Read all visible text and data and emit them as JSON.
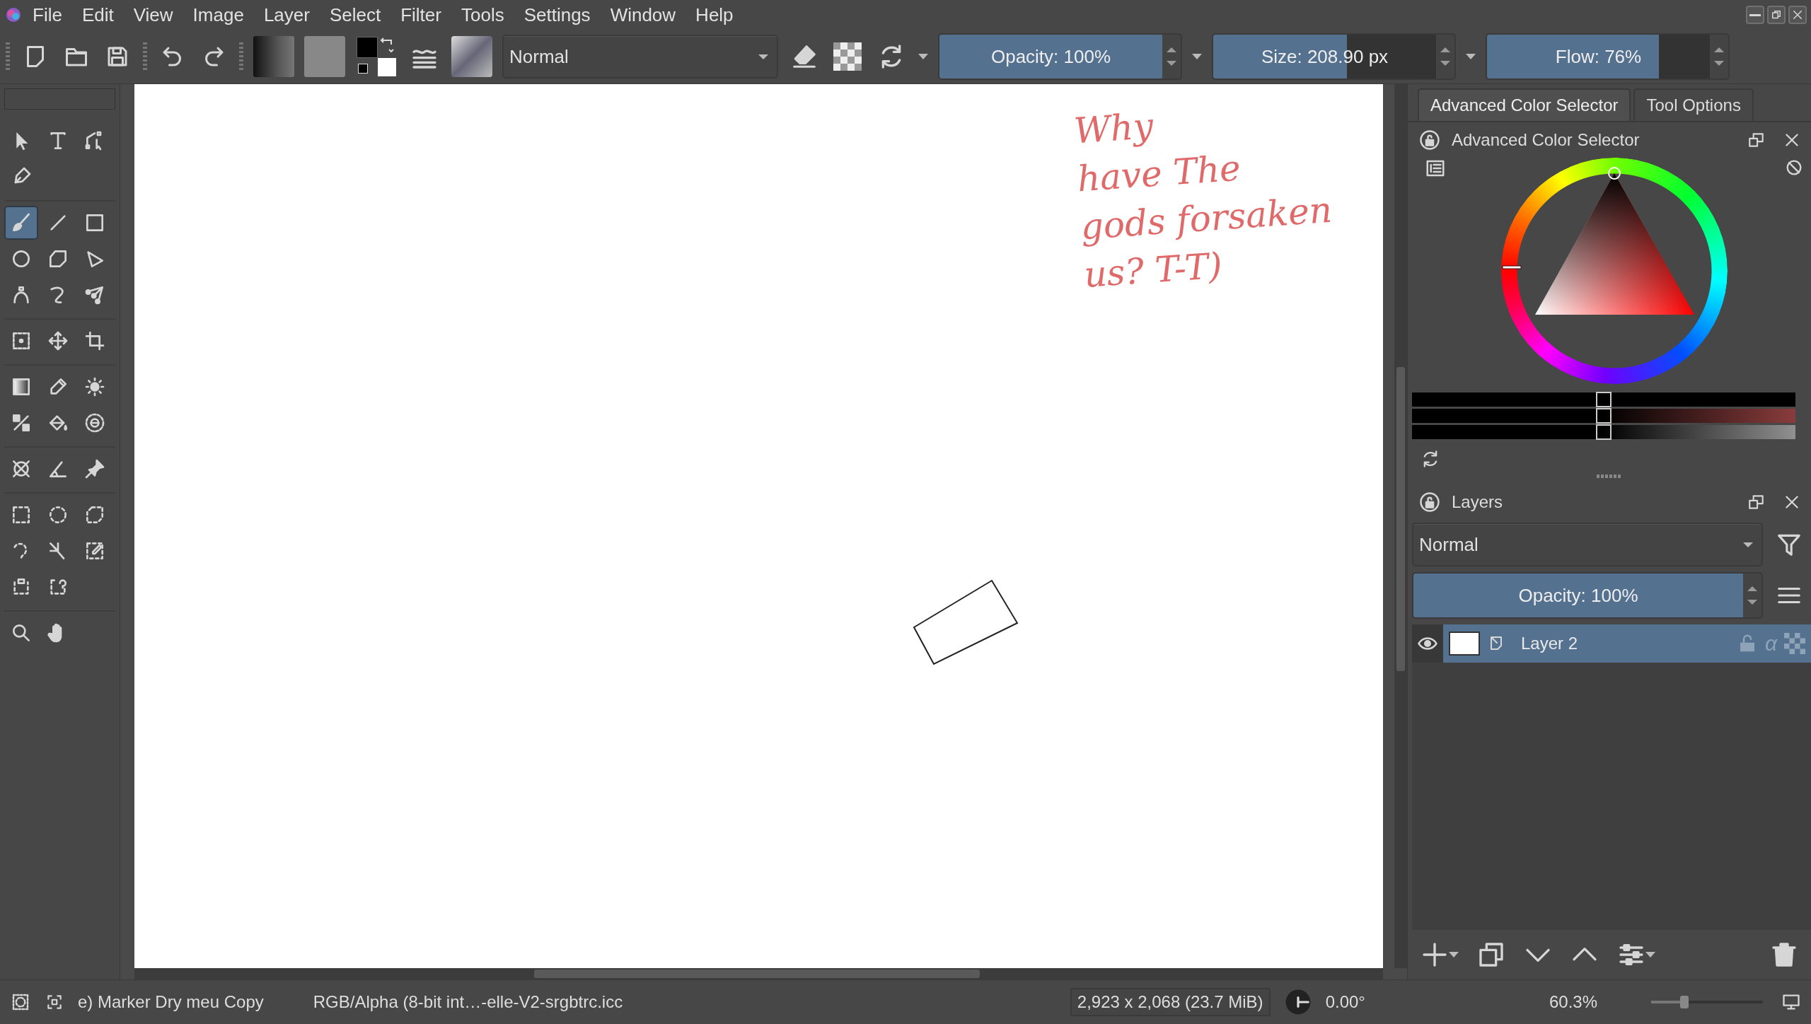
{
  "menu_bar": {
    "items": [
      "File",
      "Edit",
      "View",
      "Image",
      "Layer",
      "Select",
      "Filter",
      "Tools",
      "Settings",
      "Window",
      "Help"
    ]
  },
  "toolbar": {
    "blend_mode": "Normal",
    "sliders": [
      {
        "label": "Opacity: 100%",
        "level": 1
      },
      {
        "label": "Size: 208.90 px",
        "level": 0.6
      },
      {
        "label": "Flow: 76%",
        "level": 0.77
      }
    ]
  },
  "toolbox": {
    "groups": [
      [
        {
          "kind": "shape-select",
          "selected": false
        },
        {
          "kind": "text",
          "selected": false
        },
        {
          "kind": "edit-shapes",
          "selected": false
        },
        {
          "kind": "calligraphy",
          "selected": false
        }
      ],
      [
        {
          "kind": "brush",
          "selected": true
        },
        {
          "kind": "line",
          "selected": false
        },
        {
          "kind": "rectangle",
          "selected": false
        },
        {
          "kind": "ellipse",
          "selected": false
        },
        {
          "kind": "polygon",
          "selected": false
        },
        {
          "kind": "polyline",
          "selected": false
        },
        {
          "kind": "bezier",
          "selected": false
        },
        {
          "kind": "freehand-path",
          "selected": false
        },
        {
          "kind": "multibrush",
          "selected": false
        }
      ],
      [
        {
          "kind": "transform",
          "selected": false
        },
        {
          "kind": "move",
          "selected": false
        },
        {
          "kind": "crop",
          "selected": false
        }
      ],
      [
        {
          "kind": "gradient",
          "selected": false
        },
        {
          "kind": "color-picker",
          "selected": false
        },
        {
          "kind": "smart-patch",
          "selected": false
        },
        {
          "kind": "colorize",
          "selected": false
        },
        {
          "kind": "fill",
          "selected": false
        },
        {
          "kind": "enclose-fill",
          "selected": false
        }
      ],
      [
        {
          "kind": "assistant",
          "selected": false
        },
        {
          "kind": "measure",
          "selected": false
        },
        {
          "kind": "reference",
          "selected": false
        }
      ],
      [
        {
          "kind": "rect-select",
          "selected": false
        },
        {
          "kind": "ellipse-select",
          "selected": false
        },
        {
          "kind": "polygon-select",
          "selected": false
        },
        {
          "kind": "freehand-select",
          "selected": false
        },
        {
          "kind": "magic-wand",
          "selected": false
        },
        {
          "kind": "similar-select",
          "selected": false
        },
        {
          "kind": "bezier-select",
          "selected": false
        },
        {
          "kind": "magnetic-select",
          "selected": false
        }
      ],
      [
        {
          "kind": "zoom",
          "selected": false
        },
        {
          "kind": "pan",
          "selected": false
        }
      ]
    ]
  },
  "canvas": {
    "handwriting": [
      "Why",
      "have The",
      "gods forsaken",
      "us? T-T)"
    ]
  },
  "docker_tabs": [
    {
      "label": "Advanced Color Selector",
      "selected": true
    },
    {
      "label": "Tool Options",
      "selected": false
    }
  ],
  "color_selector": {
    "title": "Advanced Color Selector",
    "sliders": [
      {
        "level": 0.5
      },
      {
        "level": 0.5
      },
      {
        "level": 0.5
      }
    ]
  },
  "layers": {
    "title": "Layers",
    "blend_mode": "Normal",
    "opacity": {
      "label": "Opacity: 100%",
      "level": 1
    },
    "items": [
      {
        "name": "Layer 2",
        "selected": true,
        "visible": true,
        "alpha_glyph": "α"
      }
    ]
  },
  "status_bar": {
    "brush": "e) Marker Dry meu Copy",
    "color_profile": "RGB/Alpha (8-bit int…-elle-V2-srgbtrc.icc",
    "image_size": "2,923 x 2,068 (23.7 MiB)",
    "rotation": "0.00°",
    "zoom": "60.3%",
    "zoom_slider": {
      "level": 0.3
    }
  }
}
